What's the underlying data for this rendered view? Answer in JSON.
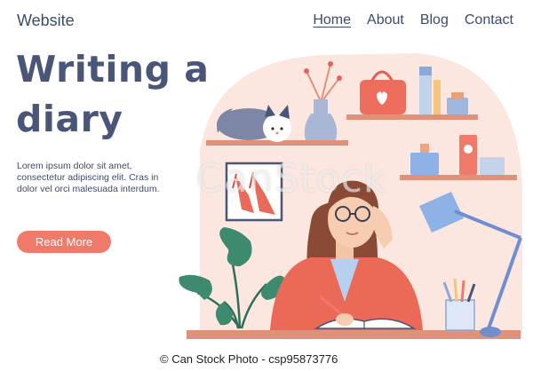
{
  "header": {
    "logo": "Website",
    "nav": [
      {
        "label": "Home",
        "active": true
      },
      {
        "label": "About",
        "active": false
      },
      {
        "label": "Blog",
        "active": false
      },
      {
        "label": "Contact",
        "active": false
      }
    ]
  },
  "hero": {
    "title": "Writing a diary",
    "body": "Lorem ipsum dolor sit amet, consectetur adipiscing elit. Cras in dolor vel orci malesuada interdum.",
    "cta_label": "Read More"
  },
  "watermark": {
    "text": "CanStock"
  },
  "footer": {
    "credit": "© Can Stock Photo - csp95873776"
  },
  "colors": {
    "accent": "#f07a6a",
    "text": "#3d4a6b",
    "backdrop": "#fbe7df"
  }
}
